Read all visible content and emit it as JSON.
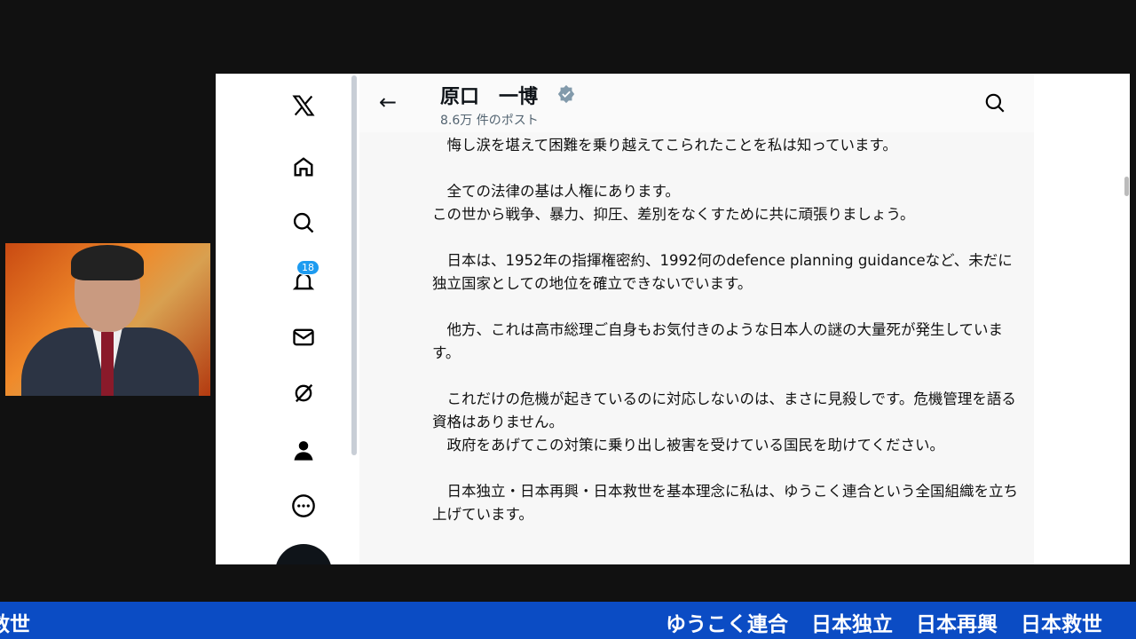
{
  "profile": {
    "name": "原口　一博",
    "posts": "8.6万 件のポスト"
  },
  "notifications_badge": "18",
  "post_paragraphs": [
    "　悔し涙を堪えて困難を乗り越えてこられたことを私は知っています。",
    "　全ての法律の基は人権にあります。\nこの世から戦争、暴力、抑圧、差別をなくすために共に頑張りましょう。",
    "　日本は、1952年の指揮権密約、1992何のdefence planning guidanceなど、未だに独立国家としての地位を確立できないでいます。",
    "　他方、これは高市総理ご自身もお気付きのような日本人の謎の大量死が発生しています。",
    "　これだけの危機が起きているのに対応しないのは、まさに見殺しです。危機管理を語る資格はありません。\n　政府をあげてこの対策に乗り出し被害を受けている国民を助けてください。",
    "　日本独立・日本再興・日本救世を基本理念に私は、ゆうこく連合という全国組織を立ち上げています。"
  ],
  "ticker": {
    "left": "救世",
    "right": "ゆうこく連合 日本独立 日本再興 日本救世"
  },
  "colors": {
    "ticker": "#0b4cc4",
    "badge": "#1d9bf0"
  }
}
